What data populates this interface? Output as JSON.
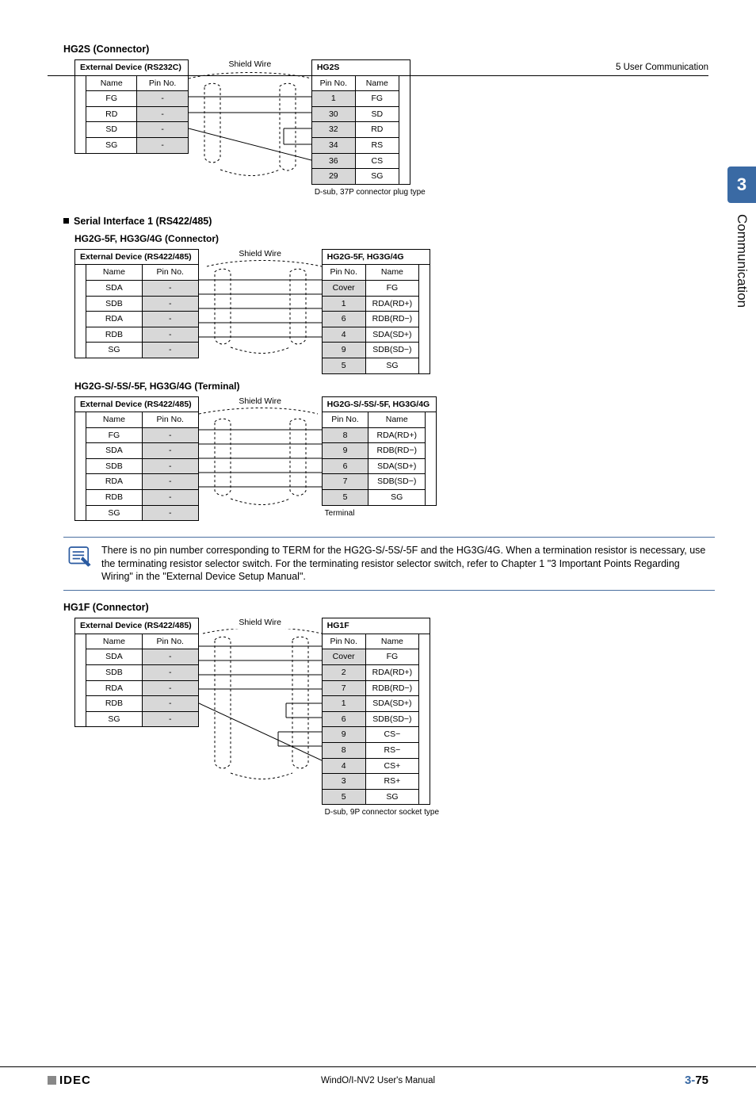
{
  "header": {
    "section": "5 User Communication"
  },
  "side": {
    "number": "3",
    "label": "Communication"
  },
  "hg2s": {
    "title": "HG2S (Connector)",
    "left_title": "External Device (RS232C)",
    "right_title": "HG2S",
    "col_name": "Name",
    "col_pin": "Pin No.",
    "shield": "Shield Wire",
    "left_rows": [
      {
        "name": "FG",
        "pin": "-"
      },
      {
        "name": "RD",
        "pin": "-"
      },
      {
        "name": "SD",
        "pin": "-"
      },
      {
        "name": "SG",
        "pin": "-"
      }
    ],
    "right_rows": [
      {
        "pin": "1",
        "name": "FG"
      },
      {
        "pin": "30",
        "name": "SD"
      },
      {
        "pin": "32",
        "name": "RD"
      },
      {
        "pin": "34",
        "name": "RS"
      },
      {
        "pin": "36",
        "name": "CS"
      },
      {
        "pin": "29",
        "name": "SG"
      }
    ],
    "foot": "D-sub, 37P connector plug type"
  },
  "si1": {
    "title": "Serial Interface 1 (RS422/485)",
    "s1": {
      "title": "HG2G-5F, HG3G/4G (Connector)",
      "left_title": "External Device (RS422/485)",
      "right_title": "HG2G-5F, HG3G/4G",
      "col_name": "Name",
      "col_pin": "Pin No.",
      "shield": "Shield Wire",
      "left_rows": [
        {
          "name": "SDA",
          "pin": "-"
        },
        {
          "name": "SDB",
          "pin": "-"
        },
        {
          "name": "RDA",
          "pin": "-"
        },
        {
          "name": "RDB",
          "pin": "-"
        },
        {
          "name": "SG",
          "pin": "-"
        }
      ],
      "right_rows": [
        {
          "pin": "Cover",
          "name": "FG"
        },
        {
          "pin": "1",
          "name": "RDA(RD+)"
        },
        {
          "pin": "6",
          "name": "RDB(RD−)"
        },
        {
          "pin": "4",
          "name": "SDA(SD+)"
        },
        {
          "pin": "9",
          "name": "SDB(SD−)"
        },
        {
          "pin": "5",
          "name": "SG"
        }
      ]
    },
    "s2": {
      "title": "HG2G-S/-5S/-5F, HG3G/4G (Terminal)",
      "left_title": "External Device (RS422/485)",
      "right_title": "HG2G-S/-5S/-5F, HG3G/4G",
      "col_name": "Name",
      "col_pin": "Pin No.",
      "shield": "Shield Wire",
      "left_rows": [
        {
          "name": "FG",
          "pin": "-"
        },
        {
          "name": "SDA",
          "pin": "-"
        },
        {
          "name": "SDB",
          "pin": "-"
        },
        {
          "name": "RDA",
          "pin": "-"
        },
        {
          "name": "RDB",
          "pin": "-"
        },
        {
          "name": "SG",
          "pin": "-"
        }
      ],
      "right_rows": [
        {
          "pin": "8",
          "name": "RDA(RD+)"
        },
        {
          "pin": "9",
          "name": "RDB(RD−)"
        },
        {
          "pin": "6",
          "name": "SDA(SD+)"
        },
        {
          "pin": "7",
          "name": "SDB(SD−)"
        },
        {
          "pin": "5",
          "name": "SG"
        }
      ],
      "foot": "Terminal"
    },
    "note": "There is no pin number corresponding to TERM for the HG2G-S/-5S/-5F and the HG3G/4G. When a termination resistor is necessary, use the terminating resistor selector switch. For the terminating resistor selector switch, refer to Chapter 1 \"3 Important Points Regarding Wiring\" in the \"External Device Setup Manual\".",
    "s3": {
      "title": "HG1F (Connector)",
      "left_title": "External Device (RS422/485)",
      "right_title": "HG1F",
      "col_name": "Name",
      "col_pin": "Pin No.",
      "shield": "Shield Wire",
      "left_rows": [
        {
          "name": "SDA",
          "pin": "-"
        },
        {
          "name": "SDB",
          "pin": "-"
        },
        {
          "name": "RDA",
          "pin": "-"
        },
        {
          "name": "RDB",
          "pin": "-"
        },
        {
          "name": "SG",
          "pin": "-"
        }
      ],
      "right_rows": [
        {
          "pin": "Cover",
          "name": "FG"
        },
        {
          "pin": "2",
          "name": "RDA(RD+)"
        },
        {
          "pin": "7",
          "name": "RDB(RD−)"
        },
        {
          "pin": "1",
          "name": "SDA(SD+)"
        },
        {
          "pin": "6",
          "name": "SDB(SD−)"
        },
        {
          "pin": "9",
          "name": "CS−"
        },
        {
          "pin": "8",
          "name": "RS−"
        },
        {
          "pin": "4",
          "name": "CS+"
        },
        {
          "pin": "3",
          "name": "RS+"
        },
        {
          "pin": "5",
          "name": "SG"
        }
      ],
      "foot": "D-sub, 9P connector socket type"
    }
  },
  "footer": {
    "brand": "IDEC",
    "center": "WindO/I-NV2 User's Manual",
    "chapter": "3-",
    "page": "75"
  }
}
